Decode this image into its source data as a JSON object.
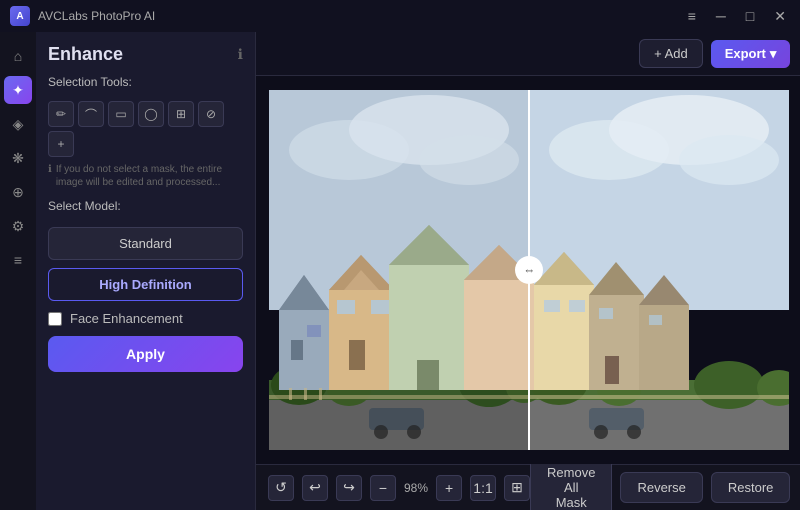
{
  "app": {
    "title": "AVCLabs PhotoPro AI",
    "logo_letter": "A"
  },
  "titlebar": {
    "menu_icon": "≡",
    "minimize": "─",
    "maximize": "□",
    "close": "✕"
  },
  "header": {
    "title": "Enhance",
    "info_icon": "ℹ"
  },
  "selection_tools": {
    "label": "Selection Tools:",
    "hint": "If you do not select a mask, the entire image will be edited and processed...",
    "tools": [
      {
        "name": "pen",
        "icon": "✏",
        "active": false
      },
      {
        "name": "lasso",
        "icon": "⌒",
        "active": false
      },
      {
        "name": "rect",
        "icon": "▭",
        "active": false
      },
      {
        "name": "ellipse",
        "icon": "◯",
        "active": false
      },
      {
        "name": "magic",
        "icon": "⊞",
        "active": false
      },
      {
        "name": "brush",
        "icon": "⊘",
        "active": false
      },
      {
        "name": "plus",
        "icon": "+",
        "active": false
      }
    ]
  },
  "select_model": {
    "label": "Select Model:",
    "options": [
      {
        "label": "Standard",
        "active": false
      },
      {
        "label": "High Definition",
        "active": true
      }
    ]
  },
  "face_enhancement": {
    "label": "Face Enhancement",
    "checked": false
  },
  "apply_btn": "Apply",
  "top_bar": {
    "add_label": "+ Add",
    "export_label": "Export",
    "export_arrow": "▾"
  },
  "zoom_controls": {
    "undo": "↺",
    "undo2": "↩",
    "redo": "↪",
    "minus": "−",
    "level": "98%",
    "plus": "+",
    "ratio": "1:1",
    "fit": "⊞"
  },
  "bottom_actions": {
    "remove_all_mask": "Remove All Mask",
    "reverse": "Reverse",
    "restore": "Restore"
  },
  "sidebar_icons": [
    {
      "name": "home",
      "icon": "⌂",
      "active": false
    },
    {
      "name": "enhance",
      "icon": "✦",
      "active": true
    },
    {
      "name": "retouch",
      "icon": "◈",
      "active": false
    },
    {
      "name": "effects",
      "icon": "❋",
      "active": false
    },
    {
      "name": "object",
      "icon": "⊕",
      "active": false
    },
    {
      "name": "adjust",
      "icon": "⚙",
      "active": false
    },
    {
      "name": "tools",
      "icon": "≡",
      "active": false
    }
  ]
}
